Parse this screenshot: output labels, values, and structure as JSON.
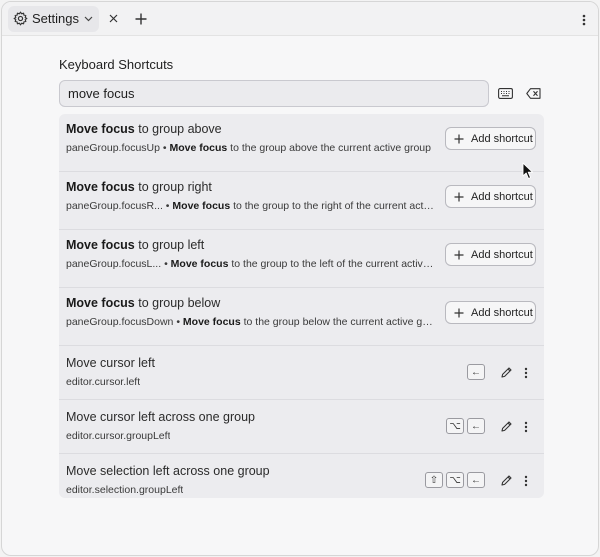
{
  "tab": {
    "title": "Settings"
  },
  "section": {
    "title": "Keyboard Shortcuts"
  },
  "search": {
    "value": "move focus"
  },
  "add_shortcut_label": "Add shortcut",
  "rows": [
    {
      "title_bold": "Move focus",
      "title_rest": " to group above",
      "command_id": "paneGroup.focusUp",
      "separator": " • ",
      "desc_bold": "Move focus",
      "desc_rest": " to the group above the current active group"
    },
    {
      "title_bold": "Move focus",
      "title_rest": " to group right",
      "command_id": "paneGroup.focusR...",
      "separator": " • ",
      "desc_bold": "Move focus",
      "desc_rest": " to the group to the right of the current activ..."
    },
    {
      "title_bold": "Move focus",
      "title_rest": " to group left",
      "command_id": "paneGroup.focusL...",
      "separator": " • ",
      "desc_bold": "Move focus",
      "desc_rest": " to the group to the left of the current active g..."
    },
    {
      "title_bold": "Move focus",
      "title_rest": " to group below",
      "command_id": "paneGroup.focusDown",
      "separator": " • ",
      "desc_bold": "Move focus",
      "desc_rest": " to the group below the current active group"
    },
    {
      "title": "Move cursor left",
      "command_id": "editor.cursor.left",
      "keys": [
        "←"
      ]
    },
    {
      "title": "Move cursor left across one group",
      "command_id": "editor.cursor.groupLeft",
      "keys": [
        "⌥",
        "←"
      ]
    },
    {
      "title": "Move selection left across one group",
      "command_id": "editor.selection.groupLeft",
      "keys": [
        "⇧",
        "⌥",
        "←"
      ]
    }
  ]
}
